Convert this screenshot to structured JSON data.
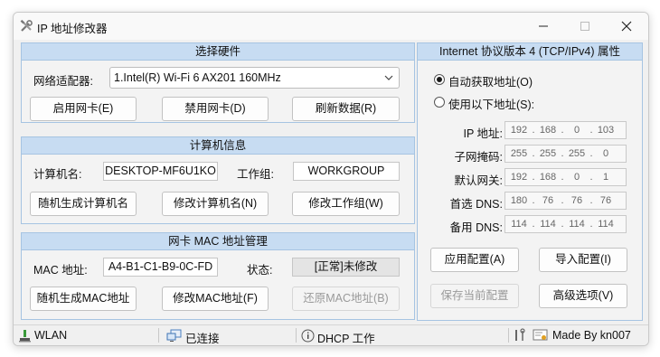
{
  "window": {
    "title": "IP 地址修改器"
  },
  "hardware": {
    "header": "选择硬件",
    "adapter_label": "网络适配器:",
    "adapter_value": "1.Intel(R) Wi-Fi 6 AX201 160MHz",
    "enable_btn": "启用网卡(E)",
    "disable_btn": "禁用网卡(D)",
    "refresh_btn": "刷新数据(R)"
  },
  "computer": {
    "header": "计算机信息",
    "name_label": "计算机名:",
    "name_value": "DESKTOP-MF6U1KO",
    "workgroup_label": "工作组:",
    "workgroup_value": "WORKGROUP",
    "random_name_btn": "随机生成计算机名",
    "modify_name_btn": "修改计算机名(N)",
    "modify_group_btn": "修改工作组(W)"
  },
  "mac": {
    "header": "网卡 MAC 地址管理",
    "mac_label": "MAC 地址:",
    "mac_value": "A4-B1-C1-B9-0C-FD",
    "state_label": "状态:",
    "state_value": "[正常]未修改",
    "random_mac_btn": "随机生成MAC地址",
    "modify_mac_btn": "修改MAC地址(F)",
    "restore_mac_btn": "还原MAC地址(B)"
  },
  "ipv4": {
    "header": "Internet 协议版本 4 (TCP/IPv4) 属性",
    "auto_label": "自动获取地址(O)",
    "manual_label": "使用以下地址(S):",
    "rows": [
      {
        "label": "IP 地址:",
        "octets": [
          "192",
          "168",
          "0",
          "103"
        ]
      },
      {
        "label": "子网掩码:",
        "octets": [
          "255",
          "255",
          "255",
          "0"
        ]
      },
      {
        "label": "默认网关:",
        "octets": [
          "192",
          "168",
          "0",
          "1"
        ]
      },
      {
        "label": "首选 DNS:",
        "octets": [
          "180",
          "76",
          "76",
          "76"
        ]
      },
      {
        "label": "备用 DNS:",
        "octets": [
          "114",
          "114",
          "114",
          "114"
        ]
      }
    ],
    "apply_btn": "应用配置(A)",
    "import_btn": "导入配置(I)",
    "save_btn": "保存当前配置",
    "advanced_btn": "高级选项(V)"
  },
  "status": {
    "wlan": "WLAN",
    "connected": "已连接",
    "dhcp": "DHCP 工作",
    "madeby": "Made By kn007"
  }
}
